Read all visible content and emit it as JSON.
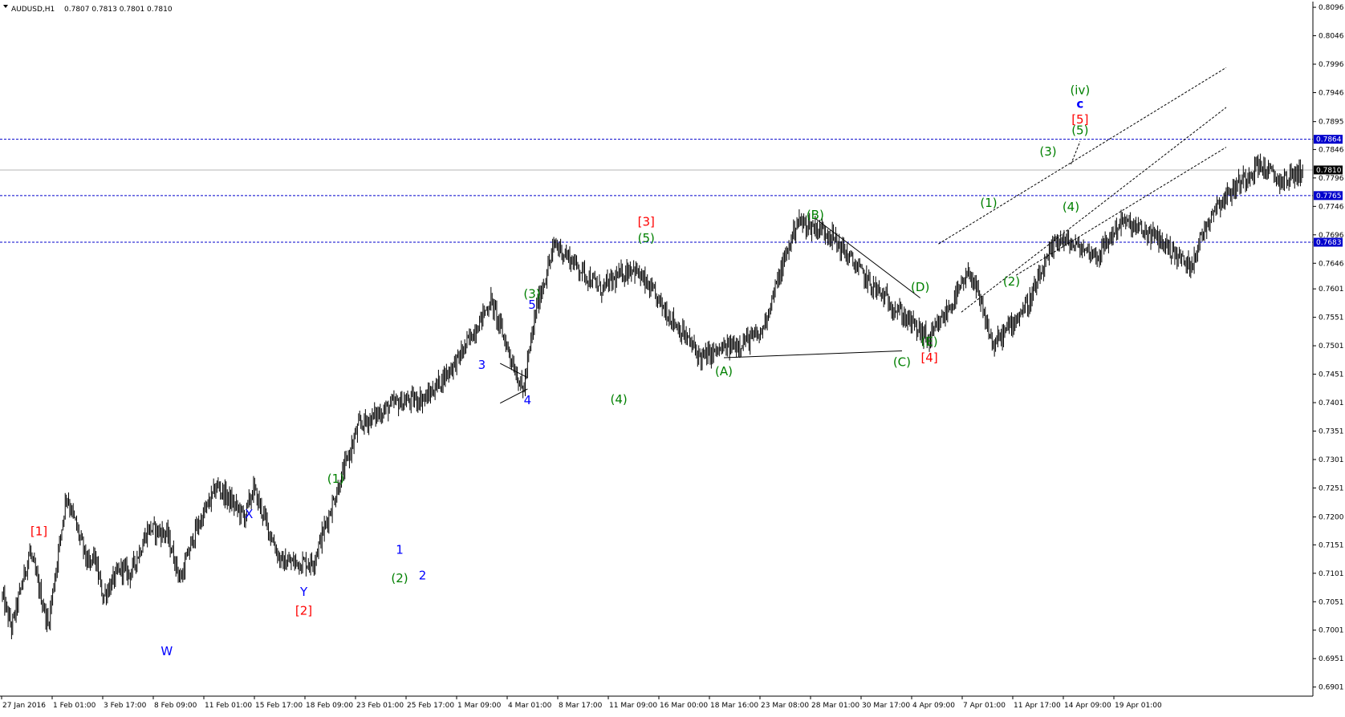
{
  "header": {
    "symbol": "AUDUSD,H1",
    "quotes": "0.7807 0.7813 0.7801 0.7810"
  },
  "colors": {
    "label_red": "#ff0000",
    "label_green": "#008000",
    "label_blue": "#0000ff",
    "level_line": "#0000cc",
    "current_price_line": "#b4b4b4",
    "candles": "#000000"
  },
  "chart_data": {
    "type": "line",
    "title": "AUDUSD,H1",
    "ohlc_last": {
      "open": 0.7807,
      "high": 0.7813,
      "low": 0.7801,
      "close": 0.781
    },
    "x_ticks": [
      "27 Jan 2016",
      "1 Feb 01:00",
      "3 Feb 17:00",
      "8 Feb 09:00",
      "11 Feb 01:00",
      "15 Feb 17:00",
      "18 Feb 09:00",
      "23 Feb 01:00",
      "25 Feb 17:00",
      "1 Mar 09:00",
      "4 Mar 01:00",
      "8 Mar 17:00",
      "11 Mar 09:00",
      "16 Mar 00:00",
      "18 Mar 16:00",
      "23 Mar 08:00",
      "28 Mar 01:00",
      "30 Mar 17:00",
      "4 Apr 09:00",
      "7 Apr 01:00",
      "11 Apr 17:00",
      "14 Apr 09:00",
      "19 Apr 01:00"
    ],
    "y_ticks": [
      "0.8096",
      "0.8046",
      "0.7996",
      "0.7946",
      "0.7895",
      "0.7846",
      "0.7796",
      "0.7746",
      "0.7696",
      "0.7646",
      "0.7601",
      "0.7551",
      "0.7501",
      "0.7451",
      "0.7401",
      "0.7351",
      "0.7301",
      "0.7251",
      "0.7200",
      "0.7151",
      "0.7101",
      "0.7051",
      "0.7001",
      "0.6951",
      "0.6901"
    ],
    "ylim": [
      0.6885,
      0.8106
    ],
    "current_price": {
      "label": "0.7810",
      "value": 0.781
    },
    "levels": [
      {
        "label": "0.7864",
        "value": 0.7864
      },
      {
        "label": "0.7765",
        "value": 0.7765
      },
      {
        "label": "0.7683",
        "value": 0.7683
      }
    ],
    "swing_points": [
      [
        0,
        0.706
      ],
      [
        2,
        0.7005
      ],
      [
        6,
        0.714
      ],
      [
        10,
        0.701
      ],
      [
        14,
        0.724
      ],
      [
        19,
        0.711
      ],
      [
        20,
        0.7135
      ],
      [
        22,
        0.706
      ],
      [
        26,
        0.711
      ],
      [
        28,
        0.71
      ],
      [
        32,
        0.718
      ],
      [
        36,
        0.717
      ],
      [
        39,
        0.709
      ],
      [
        42,
        0.717
      ],
      [
        47,
        0.7255
      ],
      [
        53,
        0.72
      ],
      [
        55,
        0.725
      ],
      [
        61,
        0.712
      ],
      [
        68,
        0.712
      ],
      [
        78,
        0.736
      ],
      [
        86,
        0.74
      ],
      [
        93,
        0.741
      ],
      [
        100,
        0.748
      ],
      [
        107,
        0.758
      ],
      [
        114,
        0.742
      ],
      [
        117,
        0.757
      ],
      [
        121,
        0.768
      ],
      [
        131,
        0.76
      ],
      [
        138,
        0.764
      ],
      [
        153,
        0.748
      ],
      [
        166,
        0.752
      ],
      [
        174,
        0.772
      ],
      [
        181,
        0.77
      ],
      [
        190,
        0.761
      ],
      [
        203,
        0.751
      ],
      [
        212,
        0.763
      ],
      [
        217,
        0.75
      ],
      [
        225,
        0.758
      ],
      [
        231,
        0.769
      ],
      [
        240,
        0.766
      ],
      [
        245,
        0.772
      ],
      [
        253,
        0.769
      ],
      [
        260,
        0.764
      ],
      [
        265,
        0.774
      ],
      [
        275,
        0.782
      ],
      [
        280,
        0.779
      ],
      [
        285,
        0.781
      ]
    ],
    "wave_labels": [
      {
        "text": "[1]",
        "color": "red",
        "x": 8,
        "value": 0.7175
      },
      {
        "text": "W",
        "color": "blue",
        "x": 36,
        "value": 0.6964
      },
      {
        "text": "X",
        "color": "blue",
        "x": 54,
        "value": 0.7205
      },
      {
        "text": "Y",
        "color": "blue",
        "x": 66,
        "value": 0.7068
      },
      {
        "text": "[2]",
        "color": "red",
        "x": 66,
        "value": 0.7035
      },
      {
        "text": "(1)",
        "color": "green",
        "x": 73,
        "value": 0.7267
      },
      {
        "text": "(2)",
        "color": "green",
        "x": 87,
        "value": 0.7092
      },
      {
        "text": "1",
        "color": "blue",
        "x": 87,
        "value": 0.7142
      },
      {
        "text": "2",
        "color": "blue",
        "x": 92,
        "value": 0.7097
      },
      {
        "text": "3",
        "color": "blue",
        "x": 105,
        "value": 0.7467
      },
      {
        "text": "4",
        "color": "blue",
        "x": 115,
        "value": 0.7405
      },
      {
        "text": "5",
        "color": "blue",
        "x": 116,
        "value": 0.7573
      },
      {
        "text": "(3)",
        "color": "green",
        "x": 116,
        "value": 0.7592
      },
      {
        "text": "(4)",
        "color": "green",
        "x": 135,
        "value": 0.7407
      },
      {
        "text": "[3]",
        "color": "red",
        "x": 141,
        "value": 0.7719
      },
      {
        "text": "(5)",
        "color": "green",
        "x": 141,
        "value": 0.769
      },
      {
        "text": "(A)",
        "color": "green",
        "x": 158,
        "value": 0.7456
      },
      {
        "text": "(B)",
        "color": "green",
        "x": 178,
        "value": 0.7731
      },
      {
        "text": "(C)",
        "color": "green",
        "x": 197,
        "value": 0.7472
      },
      {
        "text": "(D)",
        "color": "green",
        "x": 201,
        "value": 0.7604
      },
      {
        "text": "(E)",
        "color": "green",
        "x": 203,
        "value": 0.7508
      },
      {
        "text": "[4]",
        "color": "red",
        "x": 203,
        "value": 0.748
      },
      {
        "text": "(1)",
        "color": "green",
        "x": 216,
        "value": 0.7752
      },
      {
        "text": "(2)",
        "color": "green",
        "x": 221,
        "value": 0.7614
      },
      {
        "text": "(3)",
        "color": "green",
        "x": 229,
        "value": 0.7842
      },
      {
        "text": "(4)",
        "color": "green",
        "x": 234,
        "value": 0.7745
      },
      {
        "text": "(5)",
        "color": "green",
        "x": 236,
        "value": 0.788
      },
      {
        "text": "[5]",
        "color": "red",
        "x": 236,
        "value": 0.7899
      },
      {
        "text": "c",
        "color": "blue",
        "x": 236,
        "value": 0.7926
      },
      {
        "text": "(iv)",
        "color": "green",
        "x": 236,
        "value": 0.795
      }
    ]
  }
}
